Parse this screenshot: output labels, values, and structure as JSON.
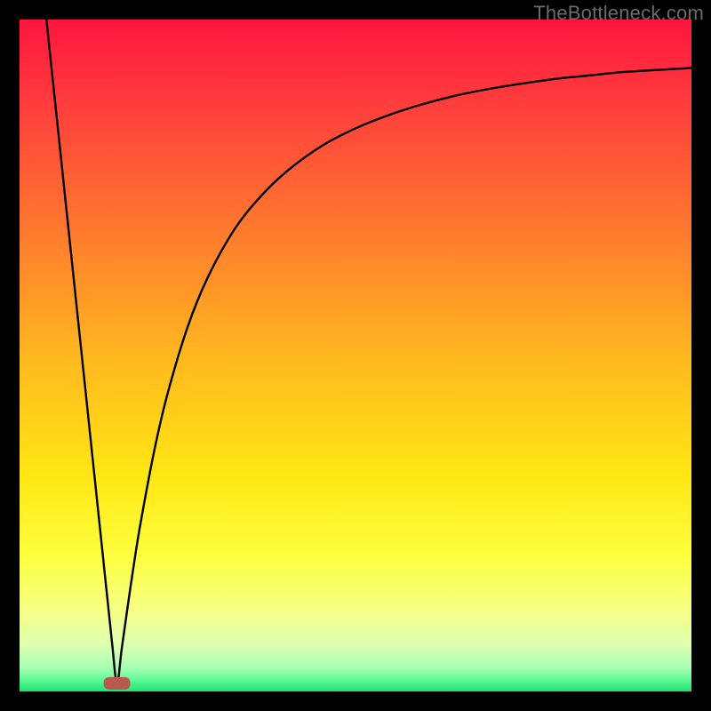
{
  "watermark": "TheBottleneck.com",
  "chart_data": {
    "type": "line",
    "title": "",
    "xlabel": "",
    "ylabel": "",
    "xlim": [
      0,
      100
    ],
    "ylim": [
      0,
      100
    ],
    "grid": false,
    "legend": false,
    "background": {
      "type": "vertical-gradient",
      "stops": [
        {
          "offset": 0.0,
          "color": "#ff153e"
        },
        {
          "offset": 0.12,
          "color": "#ff3b3d"
        },
        {
          "offset": 0.3,
          "color": "#ff752f"
        },
        {
          "offset": 0.5,
          "color": "#ffb71f"
        },
        {
          "offset": 0.68,
          "color": "#ffe714"
        },
        {
          "offset": 0.8,
          "color": "#fdff3f"
        },
        {
          "offset": 0.88,
          "color": "#f5ff86"
        },
        {
          "offset": 0.93,
          "color": "#deffb1"
        },
        {
          "offset": 0.965,
          "color": "#a7ffb5"
        },
        {
          "offset": 0.985,
          "color": "#57f993"
        },
        {
          "offset": 1.0,
          "color": "#1ee26f"
        }
      ]
    },
    "minimum_marker": {
      "x": 14.5,
      "y": 1.2,
      "color": "#b7594d"
    },
    "series": [
      {
        "name": "bottleneck-curve",
        "color": "#000000",
        "x": [
          4,
          5,
          6,
          7,
          8,
          9,
          10,
          11,
          12,
          13,
          13.8,
          14.5,
          15.2,
          16,
          17,
          18,
          20,
          22,
          25,
          28,
          32,
          36,
          40,
          45,
          50,
          55,
          60,
          65,
          70,
          75,
          80,
          85,
          90,
          95,
          100
        ],
        "y": [
          100,
          90.5,
          81,
          71.5,
          62,
          52.5,
          43,
          33.5,
          24,
          14.5,
          6.9,
          1.2,
          6.3,
          12,
          18.8,
          25,
          35.6,
          44.2,
          54.2,
          61.6,
          68.8,
          73.8,
          77.6,
          81.2,
          83.8,
          85.8,
          87.4,
          88.7,
          89.7,
          90.5,
          91.2,
          91.7,
          92.2,
          92.5,
          92.8
        ]
      }
    ]
  }
}
